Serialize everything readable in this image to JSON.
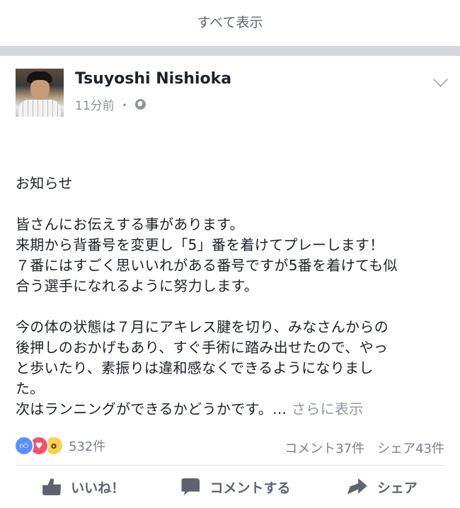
{
  "top": {
    "show_all": "すべて表示"
  },
  "post": {
    "author": "Tsuyoshi Nishioka",
    "time": "11分前",
    "separator": "・",
    "icons": {
      "privacy": "globe-icon",
      "menu": "chevron-down-icon",
      "avatar": "profile-photo"
    },
    "lines": {
      "l1": "お知らせ",
      "l2": "皆さんにお伝えする事があります。",
      "l3": "来期から背番号を変更し「5」番を着けてプレーします！",
      "l4": "７番にはすごく思いいれがある番号ですが5番を着けても似",
      "l5": "合う選手になれるように努力します。",
      "l6": "今の体の状態は７月にアキレス腱を切り、みなさんからの",
      "l7": "後押しのおかげもあり、すぐ手術に踏み出せたので、やっ",
      "l8": "と歩いたり、素振りは違和感なくできるようになりまし",
      "l9": "た。",
      "l10": "次はランニングができるかどうかです。…"
    },
    "see_more": "さらに表示"
  },
  "stats": {
    "reactions": [
      "like-icon",
      "love-icon",
      "wow-icon"
    ],
    "count": "532件",
    "comments": "コメント37件",
    "shares": "シェア43件"
  },
  "actions": {
    "like": "いいね！",
    "comment": "コメントする",
    "share": "シェア"
  },
  "colors": {
    "accent_like": "#5890ff",
    "love": "#f25268",
    "wow": "#fcd04f",
    "muted_text": "#7b818a"
  }
}
